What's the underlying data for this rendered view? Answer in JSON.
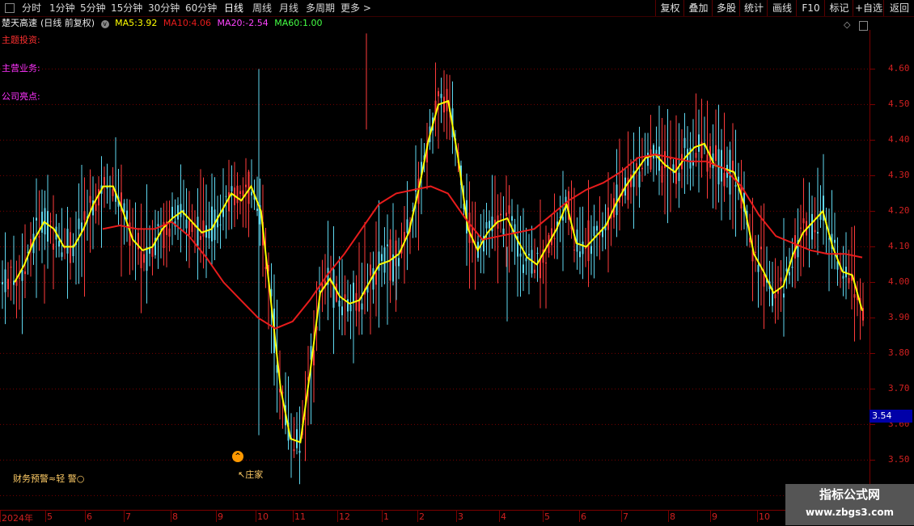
{
  "toolbar": {
    "left_items": [
      "分时",
      "1分钟",
      "5分钟",
      "15分钟",
      "30分钟",
      "60分钟",
      "日线",
      "周线",
      "月线",
      "多周期",
      "更多 >"
    ],
    "active": "日线",
    "right_items": [
      "复权",
      "叠加",
      "多股",
      "统计",
      "画线",
      "F10",
      "标记",
      "+自选",
      "返回"
    ]
  },
  "info": {
    "stock": "楚天高速",
    "mode": "(日线 前复权)",
    "ma5_label": "MA5:",
    "ma5_value": "3.92",
    "ma10_label": "MA10:",
    "ma10_value": "4.06",
    "ma20_label": "MA20:",
    "ma20_value": "-2.54",
    "ma60_label": "MA60:",
    "ma60_value": "1.00"
  },
  "side_labels": [
    "主题投资:",
    "主营业务:",
    "公司亮点:"
  ],
  "y_axis": {
    "labels": [
      "4.60",
      "4.50",
      "4.40",
      "4.30",
      "4.20",
      "4.10",
      "4.00",
      "3.90",
      "3.80",
      "3.70",
      "3.60",
      "3.50",
      "3.40"
    ],
    "current_price": "3.54"
  },
  "x_axis": {
    "labels": [
      "2024年",
      "5",
      "6",
      "7",
      "8",
      "9",
      "10",
      "11",
      "12",
      "1",
      "2",
      "3",
      "4",
      "5",
      "6",
      "7",
      "8",
      "9",
      "10"
    ]
  },
  "annotations": {
    "warning": "财务预警≈轻 警○",
    "zhuang": "↖庄家",
    "zhuang_mark": "^"
  },
  "watermark": {
    "line1": "指标公式网",
    "line2": "www.zbgs3.com"
  },
  "colors": {
    "up": "#ff3b3b",
    "down": "#5fd8f0",
    "ma5": "#ffff00",
    "ma_long": "#e81c1c",
    "grid": "#7a0000"
  },
  "chart_data": {
    "type": "line",
    "ylim": [
      3.36,
      4.71
    ],
    "series": [
      {
        "name": "MA5",
        "values": [
          4.0,
          4.05,
          4.12,
          4.17,
          4.15,
          4.1,
          4.1,
          4.15,
          4.22,
          4.27,
          4.27,
          4.2,
          4.12,
          4.09,
          4.1,
          4.15,
          4.18,
          4.2,
          4.17,
          4.14,
          4.15,
          4.2,
          4.25,
          4.23,
          4.27,
          4.2,
          3.95,
          3.7,
          3.56,
          3.55,
          3.75,
          3.97,
          4.01,
          3.96,
          3.94,
          3.95,
          4.0,
          4.05,
          4.06,
          4.08,
          4.14,
          4.26,
          4.4,
          4.5,
          4.51,
          4.35,
          4.15,
          4.09,
          4.14,
          4.17,
          4.18,
          4.12,
          4.07,
          4.05,
          4.1,
          4.15,
          4.22,
          4.11,
          4.1,
          4.13,
          4.16,
          4.22,
          4.27,
          4.31,
          4.35,
          4.36,
          4.33,
          4.31,
          4.35,
          4.38,
          4.39,
          4.33,
          4.32,
          4.31,
          4.22,
          4.08,
          4.03,
          3.97,
          3.99,
          4.08,
          4.14,
          4.17,
          4.2,
          4.1,
          4.03,
          4.02,
          3.92
        ]
      },
      {
        "name": "MA60",
        "values": [
          4.15,
          4.16,
          4.15,
          4.15,
          4.17,
          4.13,
          4.07,
          4.0,
          3.95,
          3.9,
          3.87,
          3.89,
          3.95,
          4.02,
          4.08,
          4.15,
          4.22,
          4.25,
          4.26,
          4.27,
          4.25,
          4.18,
          4.12,
          4.13,
          4.14,
          4.15,
          4.19,
          4.23,
          4.26,
          4.28,
          4.31,
          4.35,
          4.36,
          4.35,
          4.34,
          4.34,
          4.32,
          4.27,
          4.19,
          4.13,
          4.11,
          4.09,
          4.08,
          4.08,
          4.07
        ]
      }
    ]
  }
}
